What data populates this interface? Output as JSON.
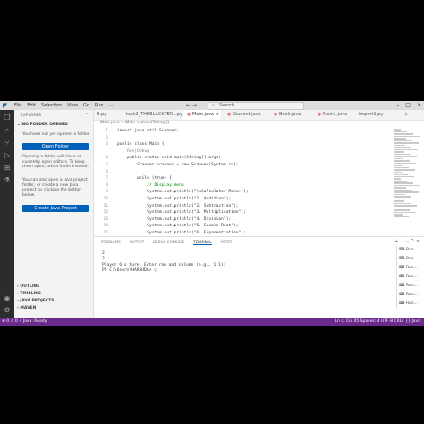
{
  "menu": [
    "File",
    "Edit",
    "Selection",
    "View",
    "Go",
    "Run",
    "···"
  ],
  "search": {
    "placeholder": "Search"
  },
  "sidebar": {
    "header": "EXPLORER",
    "section": "NO FOLDER OPENED",
    "p1": "You have not yet opened a folder.",
    "open_folder": "Open Folder",
    "p2": "Opening a folder will close all currently open editors. To keep them open, add a folder instead.",
    "p3": "You can also open a Java project folder, or create a new Java project by clicking the button below.",
    "create_java": "Create Java Project",
    "footer": [
      "OUTLINE",
      "TIMELINE",
      "JAVA PROJECTS",
      "MAVEN"
    ]
  },
  "tabs": [
    "B.py",
    "task2_THEBLACKPER...py",
    "Main.java",
    "Student.java",
    "Book.java",
    "Main1.java",
    "import1.py"
  ],
  "breadcrumb": "Main.java > Main > main(String[])",
  "editor": {
    "lines": [
      {
        "n": "1",
        "t": "import java.util.Scanner;"
      },
      {
        "n": "2",
        "t": ""
      },
      {
        "n": "3",
        "t": "public class Main {"
      },
      {
        "n": "",
        "t": "    Run|Debug"
      },
      {
        "n": "4",
        "t": "    public static void main(String[] args) {"
      },
      {
        "n": "5",
        "t": "        Scanner scanner = new Scanner(System.in);"
      },
      {
        "n": "6",
        "t": ""
      },
      {
        "n": "7",
        "t": "        while (true) {"
      },
      {
        "n": "8",
        "t": "            // Display menu"
      },
      {
        "n": "9",
        "t": "            System.out.println(\"\\nCalculator Menu:\");"
      },
      {
        "n": "10",
        "t": "            System.out.println(\"1. Addition\");"
      },
      {
        "n": "11",
        "t": "            System.out.println(\"2. Subtraction\");"
      },
      {
        "n": "12",
        "t": "            System.out.println(\"3. Multiplication\");"
      },
      {
        "n": "13",
        "t": "            System.out.println(\"4. Division\");"
      },
      {
        "n": "14",
        "t": "            System.out.println(\"5. Square Root\");"
      },
      {
        "n": "15",
        "t": "            System.out.println(\"6. Exponentiation\");"
      },
      {
        "n": "16",
        "t": "            System.out.println(\"7. Quit\");"
      }
    ]
  },
  "panel": {
    "tabs": [
      "PROBLEMS",
      "OUTPUT",
      "DEBUG CONSOLE",
      "TERMINAL",
      "PORTS"
    ],
    "terminal": [
      "2",
      "3",
      "Player O's turn. Enter row and column (e.g., 1 1):",
      "PS C:\\Users\\HARSHDA> "
    ],
    "sessions": [
      "Run...",
      "Run...",
      "Run...",
      "Run...",
      "Run...",
      "Run...",
      "Run..."
    ]
  },
  "status": {
    "left": "⊗ 0 ⚠ 0   ⚡ Java: Ready",
    "right": "Ln 4, Col 45   Spaces: 4   UTF-8   CRLF   {} Java"
  },
  "colors": {
    "status": "#6c2a8d",
    "button": "#005fb8",
    "activity": "#2c2c2c"
  }
}
